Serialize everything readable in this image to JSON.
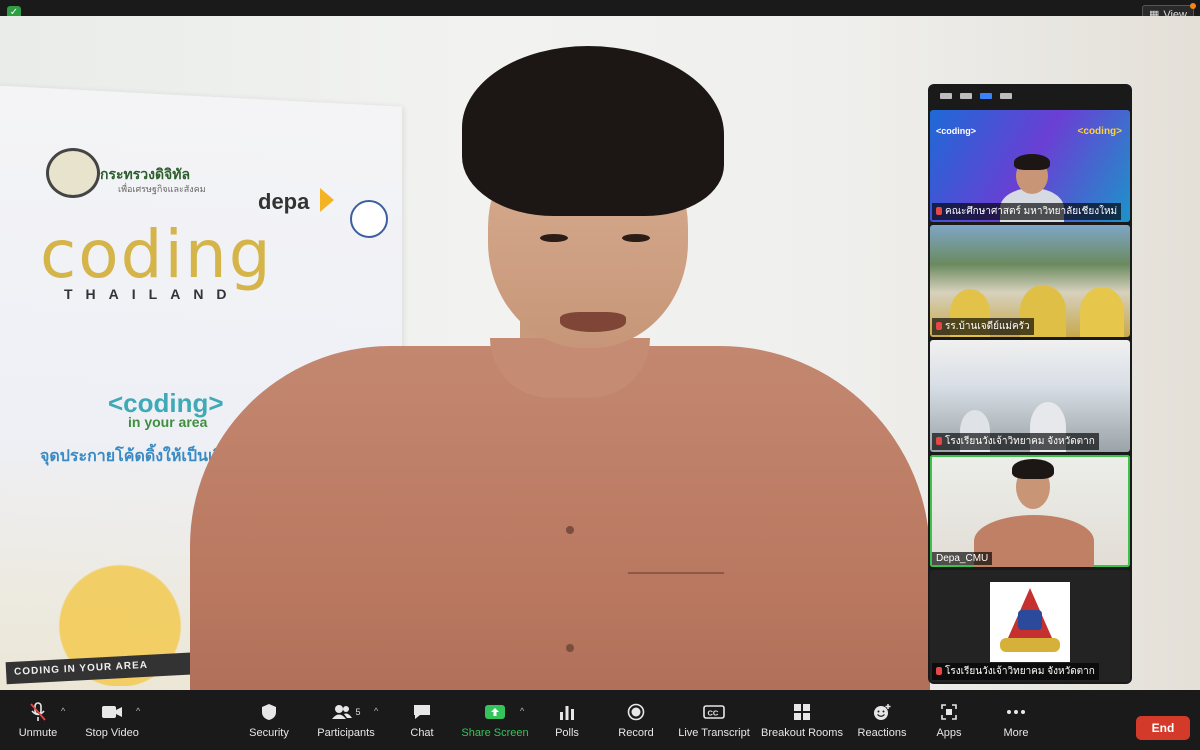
{
  "window": {
    "view_label": "View"
  },
  "stage": {
    "banner": {
      "ministry": "กระทรวงดิจิทัล",
      "ministry_sub": "เพื่อเศรษฐกิจและสังคม",
      "depa": "depa",
      "coding_big": "coding",
      "thailand": "THAILAND",
      "coding_small": "<coding>",
      "in_your_area": "in your area",
      "tagline": "จุดประกายโค้ดดิ้งให้เป็นเรื่องใกล้",
      "ribbon": "CODING IN YOUR AREA"
    }
  },
  "gallery": {
    "tiles": [
      {
        "name": "คณะศึกษาศาสตร์ มหาวิทยาลัยเชียงใหม่",
        "muted": true,
        "banner_left": "<coding>",
        "banner_right": "<coding>"
      },
      {
        "name": "รร.บ้านเจดีย์แม่ครัว",
        "muted": true
      },
      {
        "name": "โรงเรียนวังเจ้าวิทยาคม จังหวัดตาก",
        "muted": true
      },
      {
        "name": "Depa_CMU",
        "muted": false
      },
      {
        "name": "โรงเรียนวังเจ้าวิทยาคม จังหวัดตาก",
        "muted": true
      }
    ]
  },
  "toolbar": {
    "unmute": "Unmute",
    "stop_video": "Stop Video",
    "security": "Security",
    "participants": "Participants",
    "participants_count": "5",
    "chat": "Chat",
    "share_screen": "Share Screen",
    "polls": "Polls",
    "record": "Record",
    "live_transcript": "Live Transcript",
    "breakout_rooms": "Breakout Rooms",
    "reactions": "Reactions",
    "apps": "Apps",
    "more": "More",
    "end": "End"
  },
  "colors": {
    "share_green": "#35c35b",
    "end_red": "#d33a2a",
    "active_speaker": "#3cc24a"
  }
}
